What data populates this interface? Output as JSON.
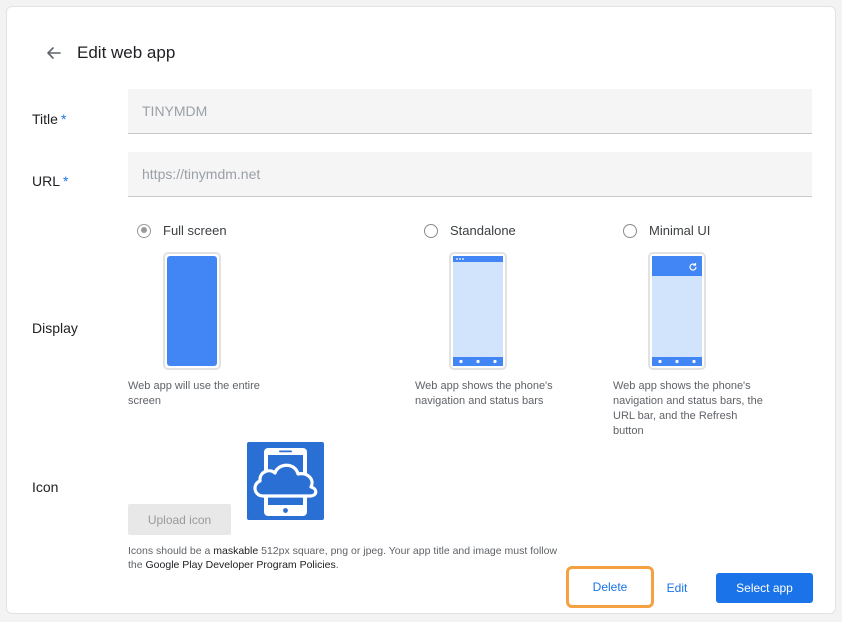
{
  "header": {
    "title": "Edit web app",
    "back_icon": "arrow-left-icon"
  },
  "form": {
    "title_label": "Title",
    "title_value": "TINYMDM",
    "url_label": "URL",
    "url_value": "https://tinymdm.net",
    "required_marker": "*",
    "display_label": "Display",
    "icon_label": "Icon"
  },
  "display": {
    "options": [
      {
        "label": "Full screen",
        "selected": true,
        "description": "Web app will use the entire screen"
      },
      {
        "label": "Standalone",
        "selected": false,
        "description": "Web app shows the phone's navigation and status bars"
      },
      {
        "label": "Minimal UI",
        "selected": false,
        "description": "Web app shows the phone's navigation and status bars, the URL bar, and the Refresh button"
      }
    ]
  },
  "icon_section": {
    "upload_label": "Upload icon",
    "help_prefix": "Icons should be a ",
    "help_link1": "maskable",
    "help_middle": " 512px square, png or jpeg. Your app title and image must follow the ",
    "help_link2": "Google Play Developer Program Policies",
    "help_suffix": "."
  },
  "actions": {
    "delete_label": "Delete",
    "edit_label": "Edit",
    "select_label": "Select app"
  },
  "colors": {
    "accent": "#1a73e8",
    "highlight": "#f5a142",
    "phone_fill": "#4285f4",
    "phone_light": "#d2e3fc",
    "icon_bg": "#2a6fd4"
  }
}
